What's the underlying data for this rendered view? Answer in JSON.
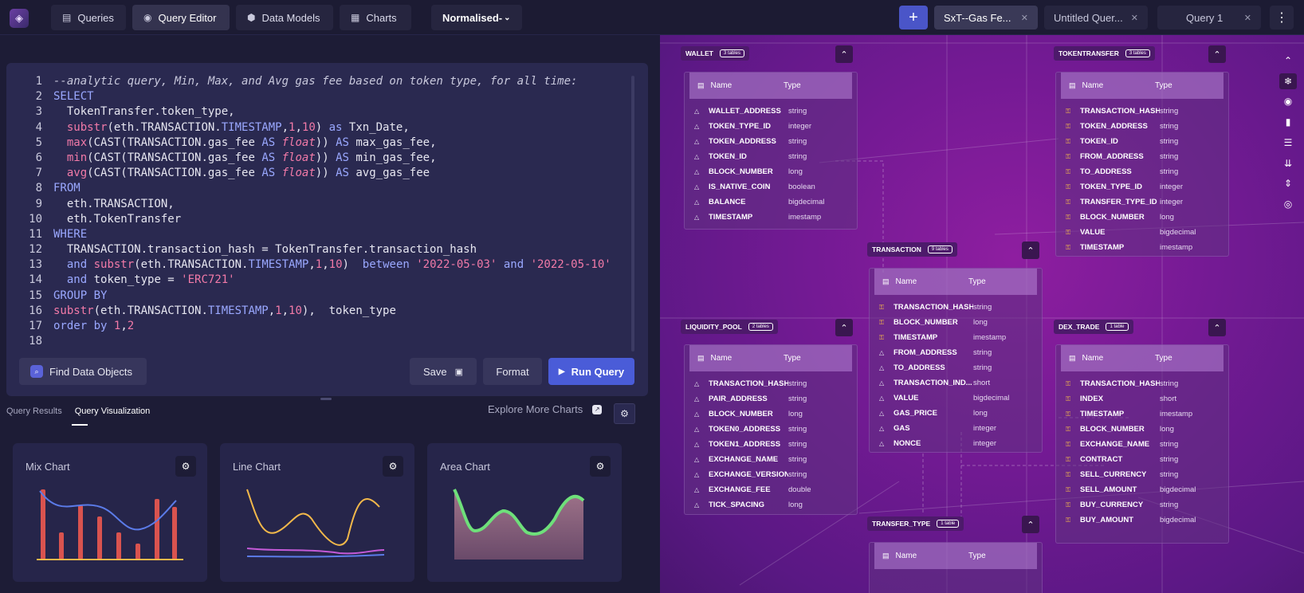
{
  "topbar": {
    "nav": [
      {
        "label": "Queries",
        "icon": "document-icon"
      },
      {
        "label": "Query Editor",
        "icon": "chat-icon"
      },
      {
        "label": "Data Models",
        "icon": "cube-icon"
      },
      {
        "label": "Charts",
        "icon": "chart-icon"
      }
    ],
    "dropdown_label": "Normalised-",
    "query_tabs": [
      "SxT--Gas Fe...",
      "Untitled Quer...",
      "Query 1"
    ]
  },
  "editor": {
    "lines": [
      "--analytic query, Min, Max, and Avg gas fee based on token type, for all time:",
      "SELECT",
      "  TokenTransfer.token_type,",
      "  substr(eth.TRANSACTION.TIMESTAMP,1,10) as Txn_Date,",
      "  max(CAST(TRANSACTION.gas_fee AS float)) AS max_gas_fee,",
      "  min(CAST(TRANSACTION.gas_fee AS float)) AS min_gas_fee,",
      "  avg(CAST(TRANSACTION.gas_fee AS float)) AS avg_gas_fee",
      "FROM",
      "  eth.TRANSACTION,",
      "  eth.TokenTransfer",
      "WHERE",
      "  TRANSACTION.transaction_hash = TokenTransfer.transaction_hash",
      "  and substr(eth.TRANSACTION.TIMESTAMP,1,10)  between '2022-05-03' and '2022-05-10'",
      "  and token_type = 'ERC721'",
      "GROUP BY",
      "substr(eth.TRANSACTION.TIMESTAMP,1,10),  token_type",
      "order by 1,2",
      ""
    ],
    "find_label": "Find Data Objects",
    "save_label": "Save",
    "format_label": "Format",
    "run_label": "Run Query"
  },
  "results": {
    "tabs": [
      "Query Results",
      "Query Visualization"
    ],
    "explore_label": "Explore More Charts",
    "cards": [
      {
        "title": "Mix Chart"
      },
      {
        "title": "Line Chart"
      },
      {
        "title": "Area Chart"
      }
    ]
  },
  "schema": {
    "tables": [
      {
        "name": "WALLET",
        "badge": "3 tables",
        "columns": [
          [
            "WALLET_ADDRESS",
            "string",
            false
          ],
          [
            "TOKEN_TYPE_ID",
            "integer",
            false
          ],
          [
            "TOKEN_ADDRESS",
            "string",
            false
          ],
          [
            "TOKEN_ID",
            "string",
            false
          ],
          [
            "BLOCK_NUMBER",
            "long",
            false
          ],
          [
            "IS_NATIVE_COIN",
            "boolean",
            false
          ],
          [
            "BALANCE",
            "bigdecimal",
            false
          ],
          [
            "TIMESTAMP",
            "imestamp",
            false
          ]
        ]
      },
      {
        "name": "TOKENTRANSFER",
        "badge": "3 tables",
        "columns": [
          [
            "TRANSACTION_HASH",
            "string",
            true
          ],
          [
            "TOKEN_ADDRESS",
            "string",
            true
          ],
          [
            "TOKEN_ID",
            "string",
            true
          ],
          [
            "FROM_ADDRESS",
            "string",
            true
          ],
          [
            "TO_ADDRESS",
            "string",
            true
          ],
          [
            "TOKEN_TYPE_ID",
            "integer",
            true
          ],
          [
            "TRANSFER_TYPE_ID",
            "integer",
            true
          ],
          [
            "BLOCK_NUMBER",
            "long",
            true
          ],
          [
            "VALUE",
            "bigdecimal",
            true
          ],
          [
            "TIMESTAMP",
            "imestamp",
            true
          ]
        ]
      },
      {
        "name": "TRANSACTION",
        "badge": "9 tables",
        "columns": [
          [
            "TRANSACTION_HASH",
            "string",
            true
          ],
          [
            "BLOCK_NUMBER",
            "long",
            true
          ],
          [
            "TIMESTAMP",
            "imestamp",
            true
          ],
          [
            "FROM_ADDRESS",
            "string",
            false
          ],
          [
            "TO_ADDRESS",
            "string",
            false
          ],
          [
            "TRANSACTION_IND...",
            "short",
            false
          ],
          [
            "VALUE",
            "bigdecimal",
            false
          ],
          [
            "GAS_PRICE",
            "long",
            false
          ],
          [
            "GAS",
            "integer",
            false
          ],
          [
            "NONCE",
            "integer",
            false
          ]
        ]
      },
      {
        "name": "LIQUIDITY_POOL",
        "badge": "2 tables",
        "columns": [
          [
            "TRANSACTION_HASH",
            "string",
            false
          ],
          [
            "PAIR_ADDRESS",
            "string",
            false
          ],
          [
            "BLOCK_NUMBER",
            "long",
            false
          ],
          [
            "TOKEN0_ADDRESS",
            "string",
            false
          ],
          [
            "TOKEN1_ADDRESS",
            "string",
            false
          ],
          [
            "EXCHANGE_NAME",
            "string",
            false
          ],
          [
            "EXCHANGE_VERSION",
            "string",
            false
          ],
          [
            "EXCHANGE_FEE",
            "double",
            false
          ],
          [
            "TICK_SPACING",
            "long",
            false
          ]
        ]
      },
      {
        "name": "DEX_TRADE",
        "badge": "1 table",
        "columns": [
          [
            "TRANSACTION_HASH",
            "string",
            true
          ],
          [
            "INDEX",
            "short",
            true
          ],
          [
            "TIMESTAMP",
            "imestamp",
            true
          ],
          [
            "BLOCK_NUMBER",
            "long",
            true
          ],
          [
            "EXCHANGE_NAME",
            "string",
            true
          ],
          [
            "CONTRACT",
            "string",
            true
          ],
          [
            "SELL_CURRENCY",
            "string",
            true
          ],
          [
            "SELL_AMOUNT",
            "bigdecimal",
            true
          ],
          [
            "BUY_CURRENCY",
            "string",
            true
          ],
          [
            "BUY_AMOUNT",
            "bigdecimal",
            true
          ]
        ]
      },
      {
        "name": "TRANSFER_TYPE",
        "badge": "1 table",
        "columns": []
      }
    ],
    "col_name_label": "Name",
    "col_type_label": "Type"
  },
  "colors": {
    "accent": "#4a5cd8",
    "canvas": "#741a94",
    "key": "#f2b84a"
  }
}
